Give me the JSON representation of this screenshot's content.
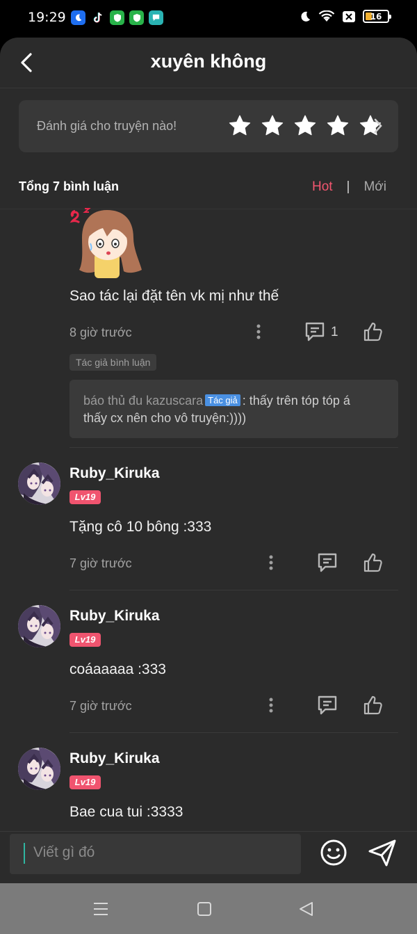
{
  "status_bar": {
    "time": "19:29",
    "battery": "16",
    "app_icons": [
      "moon-app-icon",
      "tiktok-icon",
      "shield-app-icon",
      "shield-app-icon-2",
      "chat-app-icon"
    ],
    "right_icons": [
      "do-not-disturb-icon",
      "wifi-icon",
      "sim-blocked-icon",
      "battery-icon"
    ]
  },
  "header": {
    "title": "xuyên không",
    "back_icon": "chevron-left-icon"
  },
  "rating": {
    "prompt": "Đánh giá cho truyện nào!",
    "star_count": 5,
    "stars_filled": 0
  },
  "comments_summary": {
    "total": "Tổng 7 bình luận",
    "sort_hot": "Hot",
    "sort_separator": "|",
    "sort_new": "Mới",
    "active_sort_color": "#f2566f"
  },
  "comments": [
    {
      "text": "Sao tác lại đặt tên vk mị như thế",
      "time": "8 giờ trước",
      "reply_count": "1",
      "author_chip": "Tác giả bình luận",
      "reply": {
        "name": "báo thủ đu kazuscara",
        "tag": "Tác giả",
        "text_line1": ": thấy trên tóp tóp á",
        "text_line2": "thấy cx nên cho vô truyện:))))"
      }
    },
    {
      "username": "Ruby_Kiruka",
      "level": "Lv19",
      "text": "Tặng cô 10 bông :333",
      "time": "7 giờ trước"
    },
    {
      "username": "Ruby_Kiruka",
      "level": "Lv19",
      "text": "coáaaaaa :333",
      "time": "7 giờ trước"
    },
    {
      "username": "Ruby_Kiruka",
      "level": "Lv19",
      "text": "Bae cua tui :3333"
    }
  ],
  "input": {
    "placeholder": "Viết gì đó"
  },
  "colors": {
    "background": "#2b2b2b",
    "level_badge": "#f0546f",
    "author_tag": "#4a90e2",
    "caret": "#2fb6a1"
  }
}
